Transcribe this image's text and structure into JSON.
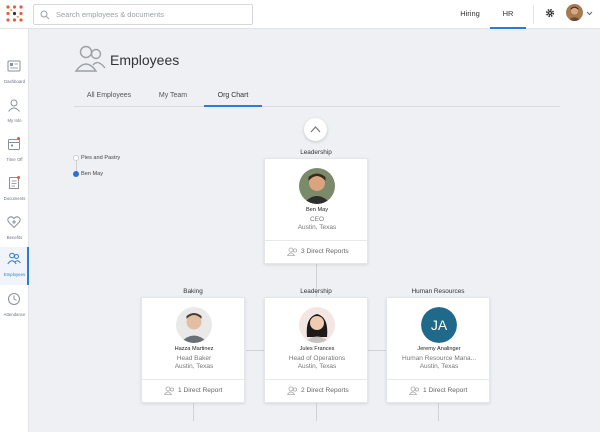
{
  "topbar": {
    "search_placeholder": "Search employees & documents",
    "nav": [
      "Hiring",
      "HR"
    ]
  },
  "sidebar": {
    "items": [
      {
        "label": "Dashboard"
      },
      {
        "label": "My Info"
      },
      {
        "label": "Time Off"
      },
      {
        "label": "Documents"
      },
      {
        "label": "Benefits"
      },
      {
        "label": "Employees"
      },
      {
        "label": "Attendance"
      }
    ]
  },
  "page": {
    "title": "Employees",
    "tabs": [
      "All Employees",
      "My Team",
      "Org Chart"
    ]
  },
  "trail": [
    "Pies and Pastry",
    "Ben May"
  ],
  "root": {
    "group": "Leadership",
    "name": "Ben May",
    "role": "CEO",
    "location": "Austin, Texas",
    "reports": "3 Direct Reports"
  },
  "children": [
    {
      "group": "Baking",
      "name": "Hazza Martinez",
      "role": "Head Baker",
      "location": "Austin, Texas",
      "reports": "1 Direct Report"
    },
    {
      "group": "Leadership",
      "name": "Jules Frances",
      "role": "Head of Operations",
      "location": "Austin, Texas",
      "reports": "2 Direct Reports"
    },
    {
      "group": "Human Resources",
      "name": "Jeremy Analinger",
      "role": "Human Resource Mana...",
      "location": "Austin, Texas",
      "reports": "1 Direct Report",
      "initials": "JA"
    }
  ],
  "colors": {
    "accent": "#2f7bd2",
    "notification": "#ef5a3c",
    "initials_bg": "#1f6a8a"
  }
}
